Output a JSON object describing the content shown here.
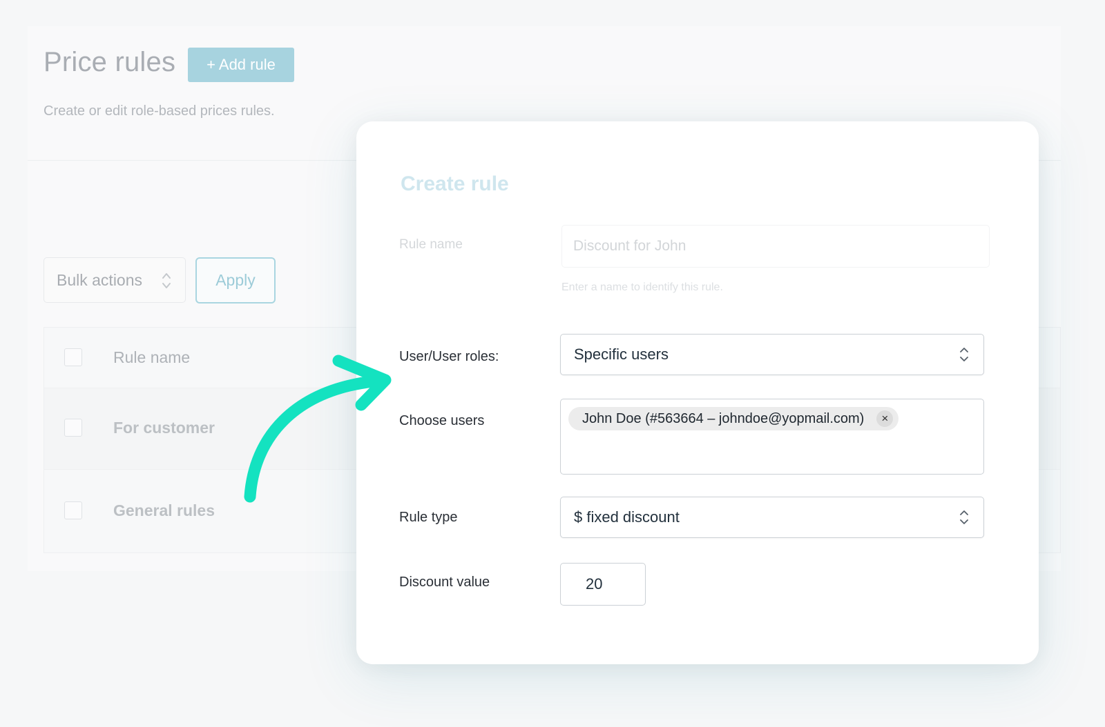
{
  "page": {
    "title": "Price rules",
    "add_button": "+ Add rule",
    "subtitle": "Create or edit role-based prices rules."
  },
  "bulk": {
    "select_value": "Bulk actions",
    "apply_label": "Apply"
  },
  "table": {
    "header": "Rule name",
    "rows": [
      "For customer",
      "General rules"
    ]
  },
  "modal": {
    "title": "Create rule",
    "rule_name": {
      "label": "Rule name",
      "placeholder": "Discount for John",
      "help": "Enter a name to identify this rule."
    },
    "user_roles": {
      "label": "User/User roles:",
      "value": "Specific users"
    },
    "choose_users": {
      "label": "Choose users",
      "tags": [
        "John Doe (#563664 – johndoe@yopmail.com)"
      ],
      "remove_glyph": "×"
    },
    "rule_type": {
      "label": "Rule type",
      "value": "$ fixed discount"
    },
    "discount_value": {
      "label": "Discount value",
      "value": "20"
    }
  },
  "colors": {
    "accent": "#a7d3df",
    "arrow": "#14e2c0",
    "text_dark": "#22303c",
    "border": "#cbd0d5"
  },
  "icons": {
    "select_chevron": "chevron-up-down-icon",
    "tag_remove": "close-icon",
    "pointer": "curved-arrow-icon"
  }
}
